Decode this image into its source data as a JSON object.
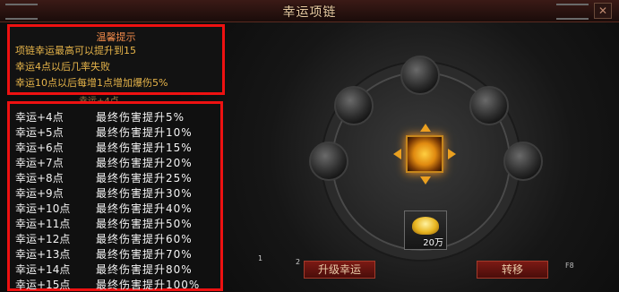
{
  "window": {
    "title": "幸运项链"
  },
  "tips": {
    "title": "温馨提示",
    "lines": [
      "项链幸运最高可以提升到15",
      "幸运4点以后几率失败",
      "幸运10点以后每增1点增加爆伤5%"
    ]
  },
  "list": {
    "header": "幸运+4点",
    "rows": [
      {
        "level": "幸运+4点",
        "bonus": "最终伤害提升5%"
      },
      {
        "level": "幸运+5点",
        "bonus": "最终伤害提升10%"
      },
      {
        "level": "幸运+6点",
        "bonus": "最终伤害提升15%"
      },
      {
        "level": "幸运+7点",
        "bonus": "最终伤害提升20%"
      },
      {
        "level": "幸运+8点",
        "bonus": "最终伤害提升25%"
      },
      {
        "level": "幸运+9点",
        "bonus": "最终伤害提升30%"
      },
      {
        "level": "幸运+10点",
        "bonus": "最终伤害提升40%"
      },
      {
        "level": "幸运+11点",
        "bonus": "最终伤害提升50%"
      },
      {
        "level": "幸运+12点",
        "bonus": "最终伤害提升60%"
      },
      {
        "level": "幸运+13点",
        "bonus": "最终伤害提升70%"
      },
      {
        "level": "幸运+14点",
        "bonus": "最终伤害提升80%"
      },
      {
        "level": "幸运+15点",
        "bonus": "最终伤害提升100%"
      }
    ]
  },
  "cost": {
    "amount": "20万",
    "icon": "gold-ingot-icon"
  },
  "slots": {
    "one": "1",
    "two": "2"
  },
  "buttons": {
    "upgrade": "升级幸运",
    "transfer": "转移",
    "transfer_hotkey": "F8"
  },
  "colors": {
    "highlight_border": "#ee1111",
    "tip_text": "#e7b54a",
    "tip_title": "#f08a4a",
    "button_bg": "#7b1a14"
  }
}
